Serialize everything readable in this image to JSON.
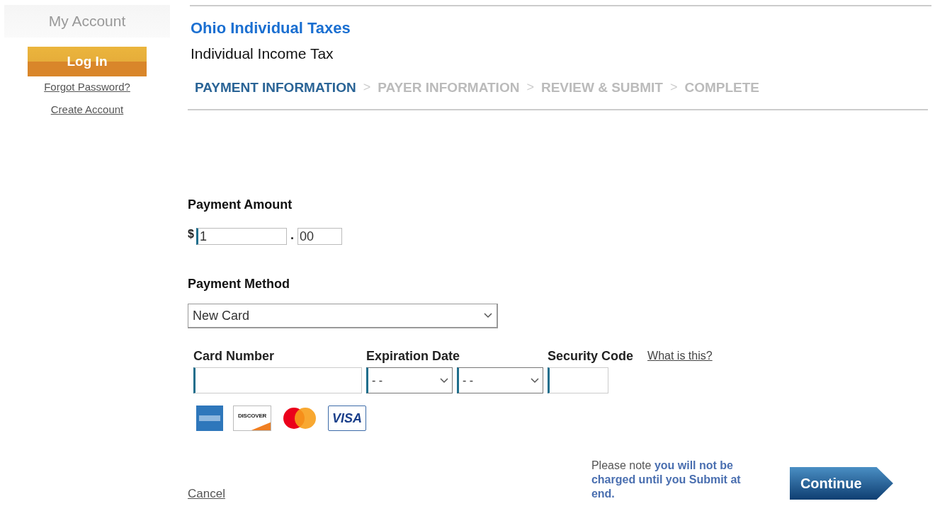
{
  "sidebar": {
    "title": "My Account",
    "login_button": "Log In",
    "links": [
      "Forgot Password?",
      "Create Account"
    ]
  },
  "header": {
    "title": "Ohio Individual Taxes",
    "subtitle": "Individual Income Tax"
  },
  "steps": [
    {
      "label": "PAYMENT INFORMATION",
      "selected": true
    },
    {
      "separator": ">",
      "label": "PAYER INFORMATION",
      "selected": false
    },
    {
      "separator": ">",
      "label": "REVIEW & SUBMIT",
      "selected": false
    },
    {
      "separator": ">",
      "label": "COMPLETE",
      "selected": false
    }
  ],
  "payment_amount": {
    "label": "Payment Amount",
    "currency": "$",
    "dollars": "1",
    "point": ".",
    "cents": "00"
  },
  "payment_method": {
    "label": "Payment Method",
    "value": "New Card"
  },
  "card_fields": [
    {
      "kind": "text",
      "label": "Card Number"
    },
    {
      "kind": "selects",
      "label": "Expiration Date",
      "values": [
        "- -",
        "- -"
      ]
    },
    {
      "kind": "text",
      "label": "Security Code",
      "help_link": "What is this?"
    }
  ],
  "cards": [
    {
      "kind": "amex"
    },
    {
      "kind": "discover",
      "label": "DISCOVER"
    },
    {
      "kind": "mastercard"
    },
    {
      "kind": "visa",
      "label": "VISA"
    }
  ],
  "footer": {
    "cancel": "Cancel",
    "note": "Please note **you will not be charged until you Submit at end.**",
    "continue_button": "Continue"
  }
}
